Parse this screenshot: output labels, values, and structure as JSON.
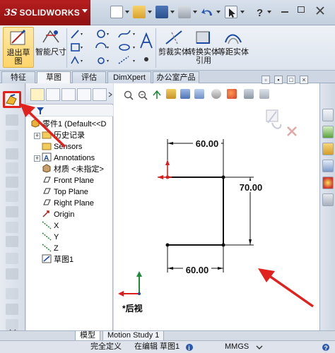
{
  "app": {
    "logo_prefix": "3S",
    "logo_name": "SOLIDWORKS"
  },
  "ribbon": {
    "exit_sketch": "退出草图",
    "smart_dimension": "智能尺寸",
    "trim_entities": "剪裁实体",
    "convert_entities": "转换实体引用",
    "offset_entities": "等距实体"
  },
  "tabs": [
    {
      "label": "特征",
      "active": false
    },
    {
      "label": "草图",
      "active": true
    },
    {
      "label": "评估",
      "active": false
    },
    {
      "label": "DimXpert",
      "active": false
    },
    {
      "label": "办公室产品",
      "active": false
    }
  ],
  "tree": {
    "root": "零件1 (Default<<D",
    "items": [
      {
        "label": "历史记录",
        "icon": "history-folder-icon"
      },
      {
        "label": "Sensors",
        "icon": "sensor-folder-icon"
      },
      {
        "label": "Annotations",
        "icon": "annotation-icon"
      },
      {
        "label": "材质 <未指定>",
        "icon": "material-icon"
      },
      {
        "label": "Front Plane",
        "icon": "plane-icon"
      },
      {
        "label": "Top Plane",
        "icon": "plane-icon"
      },
      {
        "label": "Right Plane",
        "icon": "plane-icon"
      },
      {
        "label": "Origin",
        "icon": "origin-icon"
      },
      {
        "label": "X",
        "icon": "axis-icon"
      },
      {
        "label": "Y",
        "icon": "axis-icon"
      },
      {
        "label": "Z",
        "icon": "axis-icon"
      },
      {
        "label": "草图1",
        "icon": "sketch-icon"
      }
    ]
  },
  "sketch": {
    "dim_top": "60.00",
    "dim_right": "70.00",
    "dim_bottom": "60.00"
  },
  "view": {
    "name": "*后视"
  },
  "bottom_tabs": [
    {
      "label": "模型",
      "active": true
    },
    {
      "label": "Motion Study 1",
      "active": false
    }
  ],
  "status": {
    "definition": "完全定义",
    "editing": "在编辑 草图1",
    "units": "MMGS"
  },
  "colors": {
    "accent_red": "#e0211d",
    "logo_red": "#a81818",
    "sketch_black": "#111111"
  }
}
